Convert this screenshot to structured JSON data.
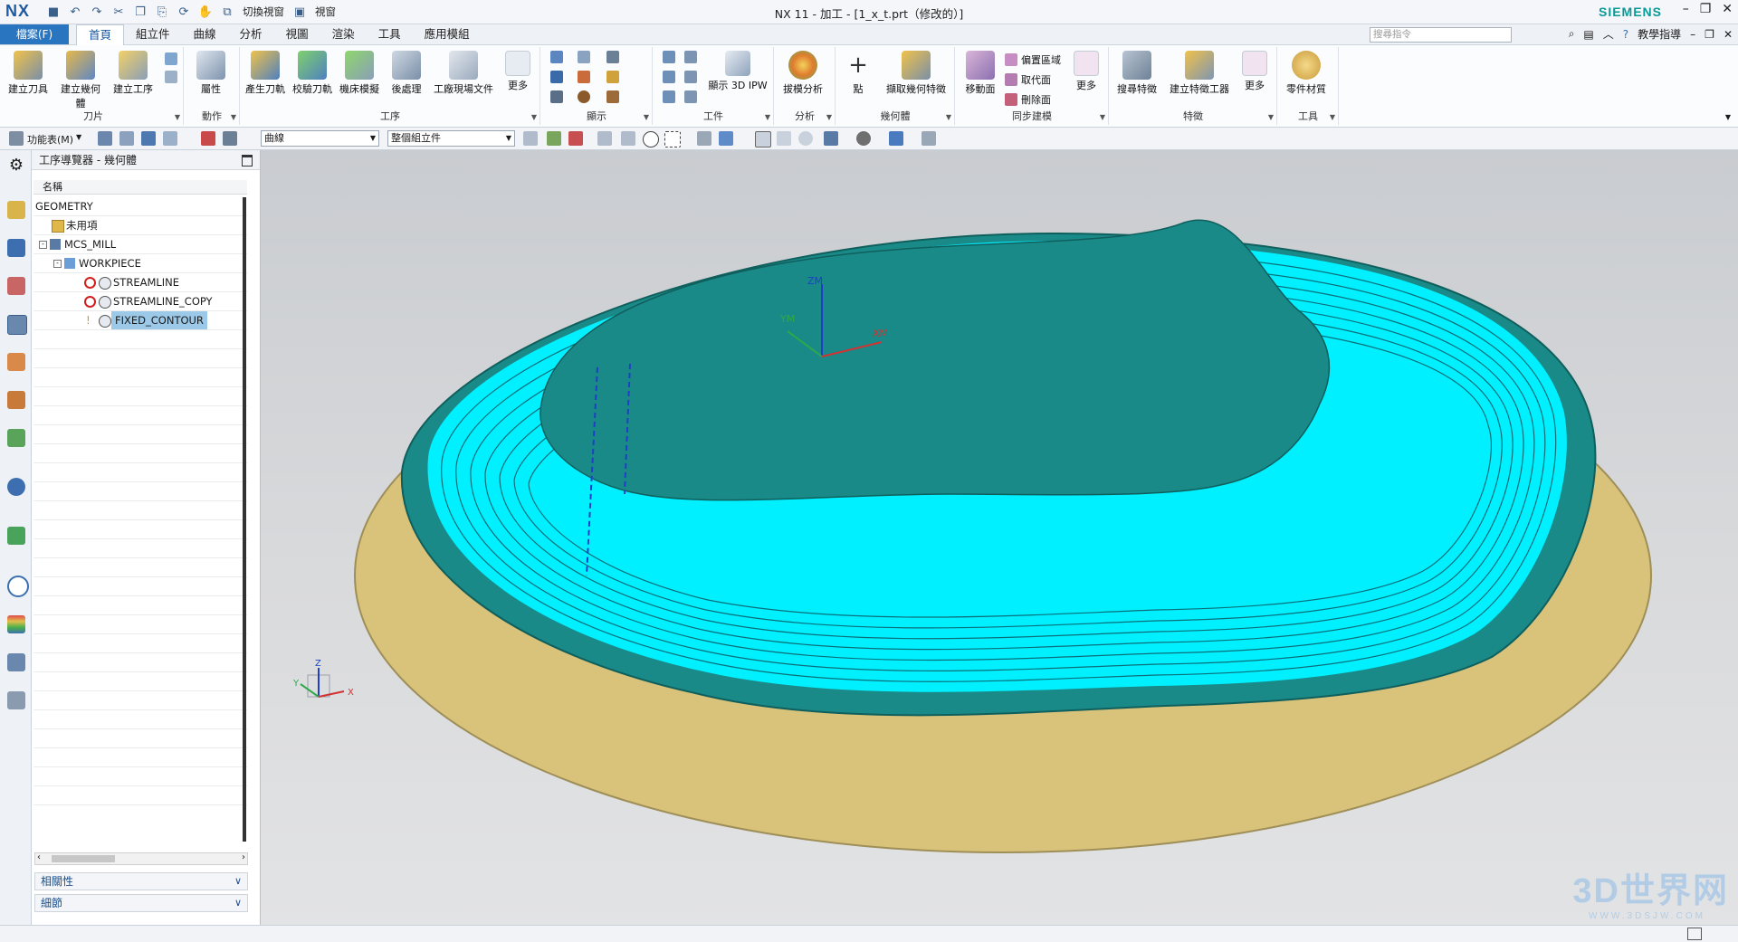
{
  "app": {
    "logo": "NX",
    "window_title": "NX 11 - 加工 - [1_x_t.prt（修改的）]",
    "brand": "SIEMENS",
    "quick_access": {
      "switch_window": "切換視窗",
      "window": "視窗"
    }
  },
  "menu": {
    "file_tab": "檔案(F)",
    "tabs": [
      "首頁",
      "組立件",
      "曲線",
      "分析",
      "視圖",
      "渲染",
      "工具",
      "應用模組"
    ],
    "active_tab": "首頁",
    "search_placeholder": "搜尋指令",
    "help_label": "教學指導"
  },
  "ribbon": {
    "groups": [
      {
        "label": "刀片",
        "buttons": [
          "建立刀具",
          "建立幾何體",
          "建立工序"
        ]
      },
      {
        "label": "動作",
        "buttons": [
          "屬性"
        ]
      },
      {
        "label": "工序",
        "buttons": [
          "產生刀軌",
          "校驗刀軌",
          "機床模擬",
          "後處理",
          "工廠現場文件",
          "更多"
        ]
      },
      {
        "label": "顯示",
        "buttons": []
      },
      {
        "label": "工件",
        "buttons": [
          "顯示 3D IPW"
        ]
      },
      {
        "label": "分析",
        "buttons": [
          "拔模分析"
        ]
      },
      {
        "label": "幾何體",
        "buttons": [
          "點",
          "擷取幾何特徵"
        ]
      },
      {
        "label": "同步建模",
        "buttons": [
          "移動面",
          "偏置區域",
          "取代面",
          "刪除面",
          "更多"
        ]
      },
      {
        "label": "特徵",
        "buttons": [
          "搜尋特徵",
          "建立特徵工器",
          "更多"
        ]
      },
      {
        "label": "工具",
        "buttons": [
          "零件材質"
        ]
      }
    ]
  },
  "toolbar2": {
    "menu_label": "功能表(M)",
    "filter_value": "曲線",
    "scope_value": "整個組立件"
  },
  "navigator": {
    "title": "工序導覽器 - 幾何體",
    "column_header": "名稱",
    "rows": [
      {
        "label": "GEOMETRY",
        "depth": 0,
        "icon": "none"
      },
      {
        "label": "未用項",
        "depth": 1,
        "icon": "folder-icon"
      },
      {
        "label": "MCS_MILL",
        "depth": 1,
        "icon": "mcs-icon"
      },
      {
        "label": "WORKPIECE",
        "depth": 2,
        "icon": "workpiece-icon"
      },
      {
        "label": "STREAMLINE",
        "depth": 3,
        "icon": "operation-icon",
        "status": "error"
      },
      {
        "label": "STREAMLINE_COPY",
        "depth": 3,
        "icon": "operation-icon",
        "status": "error"
      },
      {
        "label": "FIXED_CONTOUR",
        "depth": 3,
        "icon": "operation-icon",
        "status": "pending",
        "selected": true
      }
    ],
    "accordions": [
      "相關性",
      "細節"
    ]
  },
  "viewport": {
    "axis_labels": {
      "zm": "ZM",
      "ym": "YM",
      "xm": "XM"
    },
    "triad_labels": {
      "z": "Z",
      "y": "Y",
      "x": "X"
    }
  },
  "watermark": {
    "main": "3D世界网",
    "sub": "WWW.3DSJW.COM"
  },
  "colors": {
    "toolpath": "#00f0ff",
    "part_floor": "#1a8a88",
    "stock_plate": "#d9c27a",
    "accent": "#2a75c0"
  }
}
